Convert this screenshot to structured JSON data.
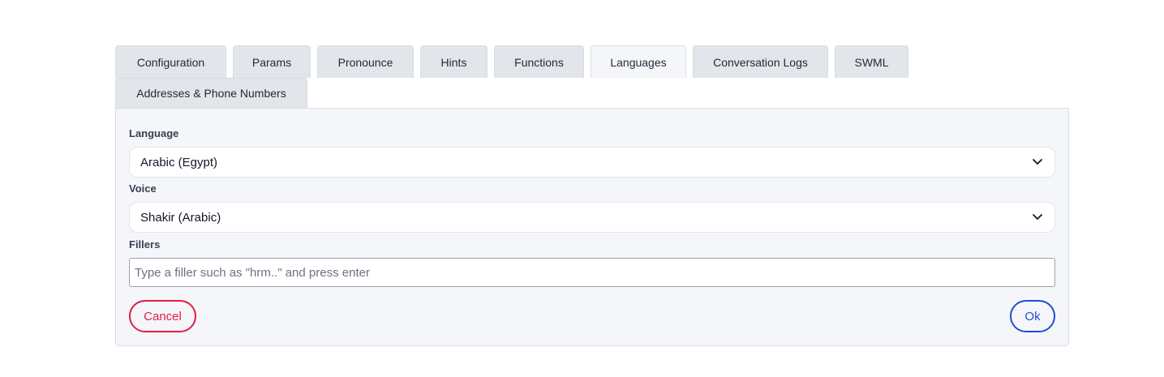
{
  "tabs": [
    {
      "label": "Configuration"
    },
    {
      "label": "Params"
    },
    {
      "label": "Pronounce"
    },
    {
      "label": "Hints"
    },
    {
      "label": "Functions"
    },
    {
      "label": "Languages",
      "active": true
    },
    {
      "label": "Conversation Logs"
    },
    {
      "label": "SWML"
    },
    {
      "label": "Addresses & Phone Numbers"
    }
  ],
  "form": {
    "language_label": "Language",
    "language_value": "Arabic (Egypt)",
    "voice_label": "Voice",
    "voice_value": "Shakir (Arabic)",
    "fillers_label": "Fillers",
    "fillers_placeholder": "Type a filler such as \"hrm..\" and press enter",
    "fillers_value": ""
  },
  "actions": {
    "cancel_label": "Cancel",
    "ok_label": "Ok"
  },
  "colors": {
    "cancel": "#e11d48",
    "ok": "#1d4ed8",
    "tab_bg": "#e2e5ea",
    "panel_bg": "#f5f6f9"
  },
  "icons": {
    "select_chevron": "chevron-down-icon"
  }
}
